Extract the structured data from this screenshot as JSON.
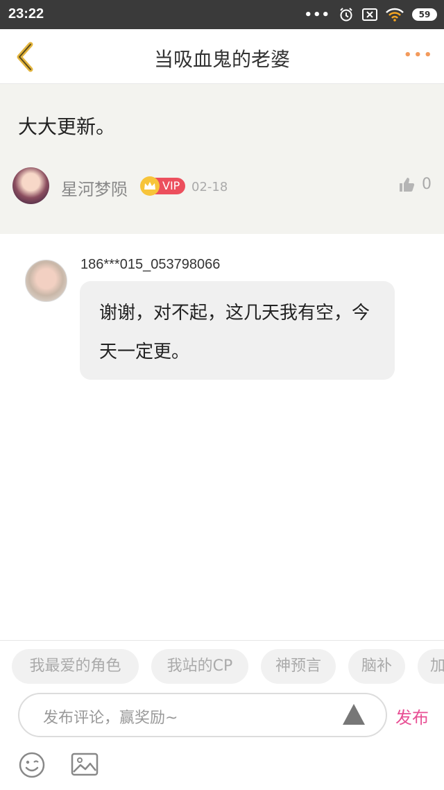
{
  "status_bar": {
    "time": "23:22",
    "battery": "59"
  },
  "header": {
    "title": "当吸血鬼的老婆"
  },
  "post": {
    "text": "大大更新。",
    "author": "星河梦陨",
    "vip_label": "VIP",
    "date": "02-18",
    "likes": "0"
  },
  "reply": {
    "username": "186***015_053798066",
    "text": "谢谢，对不起，这几天我有空，今天一定更。"
  },
  "tags": [
    "我最爱的角色",
    "我站的CP",
    "神预言",
    "脑补",
    "加"
  ],
  "comment": {
    "placeholder": "发布评论，赢奖励~",
    "publish_label": "发布"
  },
  "colors": {
    "accent_orange": "#f39a5b",
    "publish_pink": "#e84f94",
    "vip_red": "#ec4f5d",
    "crown_gold": "#f7c43a",
    "post_bg": "#f3f3ef"
  },
  "icons": [
    "back-chevron-icon",
    "more-dots-icon",
    "thumbs-up-icon",
    "send-arrow-icon",
    "emoji-icon",
    "image-icon",
    "crown-icon"
  ]
}
